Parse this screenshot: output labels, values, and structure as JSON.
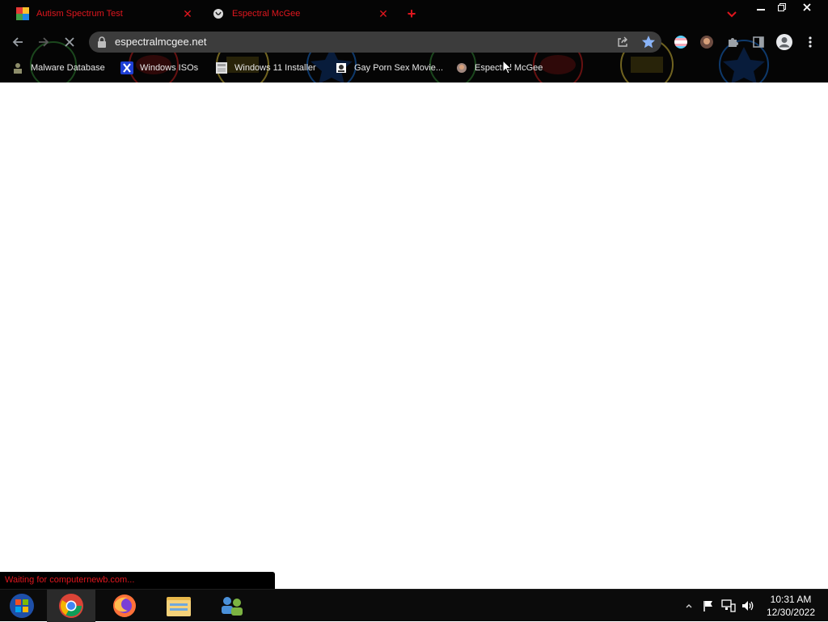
{
  "tabs": [
    {
      "title": "Autism Spectrum Test",
      "favicon": "multicolor-grid-favicon",
      "close": "✕",
      "color": "#e0161e"
    },
    {
      "title": "Espectral McGee",
      "favicon": "espectral-favicon",
      "close": "✕",
      "color": "#e0161e"
    }
  ],
  "newtab_label": "+",
  "address": {
    "url": "espectralmcgee.net"
  },
  "bookmarks": [
    {
      "label": "Malware Database",
      "icon": "malware-db-icon"
    },
    {
      "label": "Windows ISOs",
      "icon": "x-logo-icon"
    },
    {
      "label": "Windows 11 Installer",
      "icon": "installer-icon"
    },
    {
      "label": "Gay Porn Sex Movie...",
      "icon": "site-icon"
    },
    {
      "label": "Espectral McGee",
      "icon": "espectral-icon"
    }
  ],
  "status": {
    "text": "Waiting for computernewb.com..."
  },
  "taskbar": {
    "apps": [
      "start-orb",
      "chrome",
      "firefox",
      "file-explorer",
      "network-app"
    ]
  },
  "clock": {
    "time": "10:31 AM",
    "date": "12/30/2022"
  },
  "colors": {
    "accent_red": "#e0161e",
    "chrome_bg": "#050505",
    "omnibox_bg": "#3c3c3c",
    "star_blue": "#8ab4f8"
  }
}
